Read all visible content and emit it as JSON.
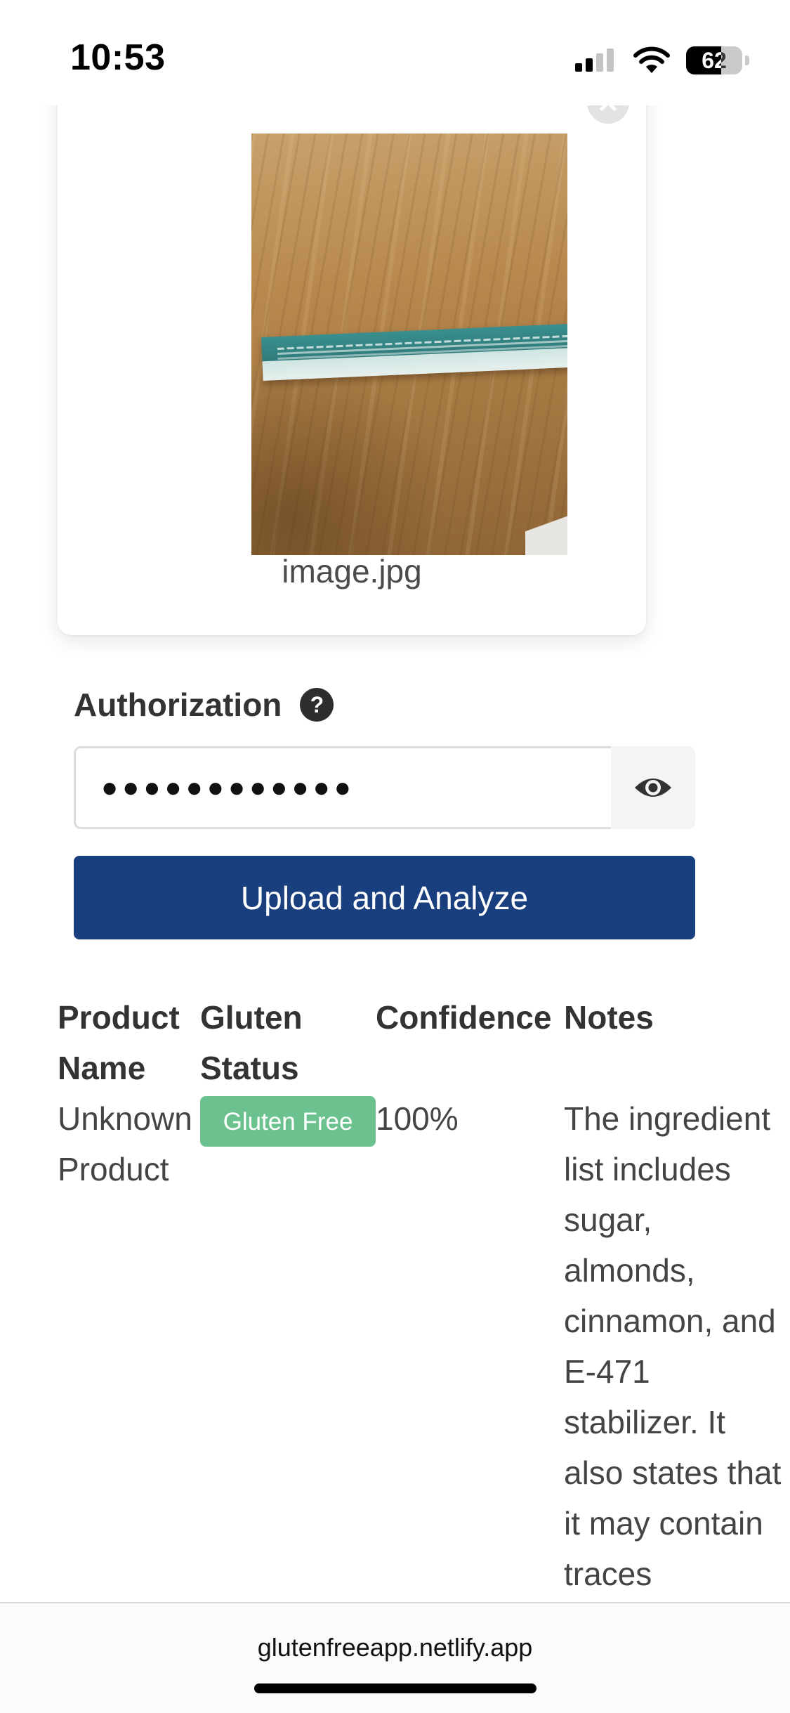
{
  "status_bar": {
    "time": "10:53",
    "battery_level": "62",
    "battery_fraction": 0.62
  },
  "upload": {
    "file_name": "image.jpg",
    "remove_icon": "close-icon"
  },
  "auth": {
    "label": "Authorization",
    "help_glyph": "?",
    "masked_value": "●●●●●●●●●●●●",
    "toggle_icon": "eye-icon"
  },
  "actions": {
    "upload_label": "Upload and Analyze"
  },
  "results": {
    "headers": {
      "product_name": "Product Name",
      "gluten_status": "Gluten Status",
      "confidence": "Confidence",
      "notes": "Notes"
    },
    "rows": [
      {
        "product_name": "Unknown Product",
        "gluten_status": "Gluten Free",
        "confidence": "100%",
        "notes": "The ingredient list includes sugar, almonds, cinnamon, and E-471 stabilizer. It also states that it may contain traces"
      }
    ],
    "status_color": "#6cc28e"
  },
  "browser": {
    "url": "glutenfreeapp.netlify.app"
  },
  "colors": {
    "primary_button": "#1a3f7e",
    "badge_green": "#6cc28e"
  }
}
